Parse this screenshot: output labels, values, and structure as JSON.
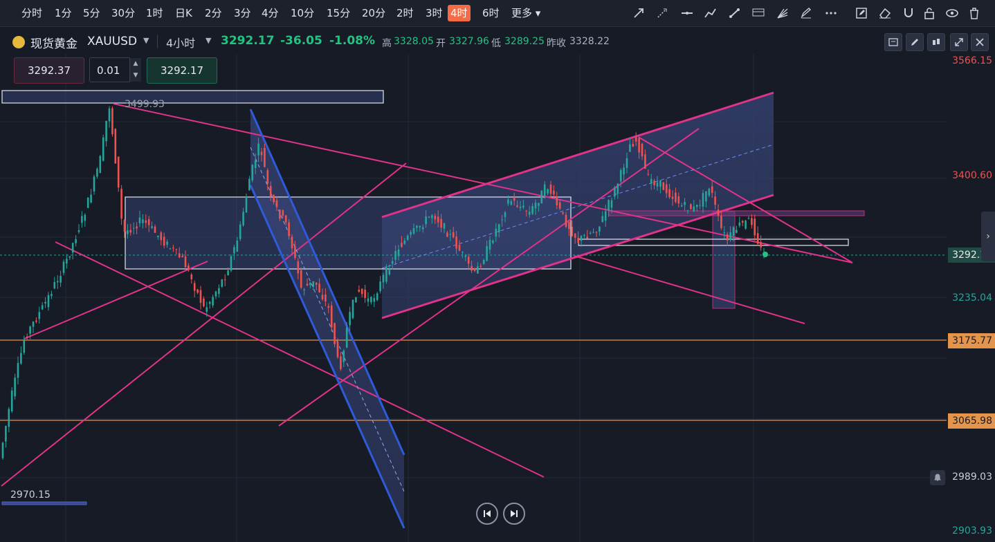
{
  "timeframes": [
    "分时",
    "1分",
    "5分",
    "30分",
    "1时",
    "日K",
    "2分",
    "3分",
    "4分",
    "10分",
    "15分",
    "20分",
    "2时",
    "3时",
    "4时",
    "6时",
    "更多"
  ],
  "active_timeframe": "4时",
  "tools": [
    "arrow-tool-icon",
    "ray-tool-icon",
    "horizontal-line-icon",
    "polyline-icon",
    "trend-line-icon",
    "fibonacci-icon",
    "fan-icon",
    "brush-icon",
    "more-dots-icon",
    "note-icon",
    "eraser-icon",
    "magnet-icon",
    "lock-icon",
    "eye-icon",
    "trash-icon"
  ],
  "symbol": {
    "name": "现货黄金",
    "code": "XAUUSD",
    "interval": "4小时",
    "last": "3292.17",
    "change": "-36.05",
    "change_pct": "-1.08%",
    "high_label": "高",
    "high": "3328.05",
    "open_label": "开",
    "open": "3327.96",
    "low_label": "低",
    "low": "3289.25",
    "prev_label": "昨收",
    "prev": "3328.22"
  },
  "order": {
    "sell_price": "3292.37",
    "lot": "0.01",
    "buy_price": "3292.17"
  },
  "annotations": {
    "peak_label": "3499.93",
    "low_label": "2970.15"
  },
  "price_axis": {
    "p1": "3566.15",
    "p2": "3400.60",
    "current": "3292.17",
    "p3": "3235.04",
    "line1": "3175.77",
    "line2": "3065.98",
    "p4": "2989.03",
    "p5": "2903.93"
  },
  "colors": {
    "up": "#26a69a",
    "down": "#ef5350",
    "accent": "#f36c45",
    "magenta": "#e0338a",
    "blue_channel": "#2f5bd9",
    "orange_line": "#e5944c"
  }
}
